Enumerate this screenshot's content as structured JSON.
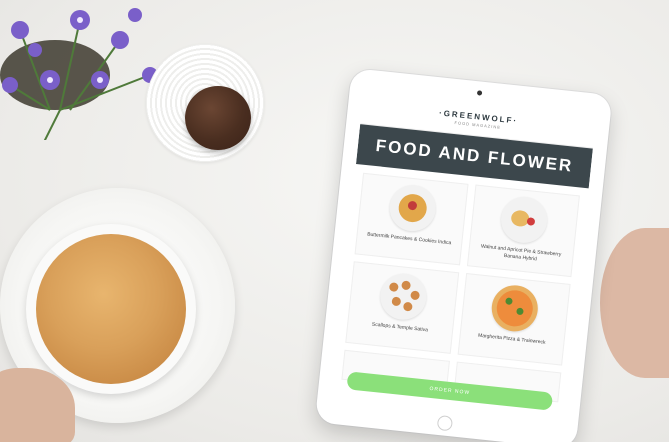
{
  "brand": {
    "name": "·GREENWOLF·",
    "subtitle": "FOOD MAGAZINE"
  },
  "banner": {
    "title": "FOOD AND FLOWER"
  },
  "menu_items": [
    {
      "label": "Buttermilk Pancakes & Cookies Indica"
    },
    {
      "label": "Walnut and Apricot Pie & Strawberry Banana Hybrid"
    },
    {
      "label": "Scallops & Temple Sativa"
    },
    {
      "label": "Margherita Pizza & Trainwreck"
    }
  ],
  "order_button": {
    "label": "ORDER NOW"
  },
  "colors": {
    "banner_bg": "#3c474c",
    "order_button": "#8be07a"
  }
}
